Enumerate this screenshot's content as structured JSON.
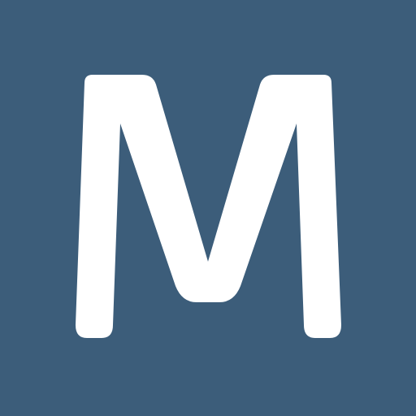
{
  "icon": {
    "letter": "M",
    "background_color": "#3c5d7a",
    "foreground_color": "#ffffff"
  }
}
